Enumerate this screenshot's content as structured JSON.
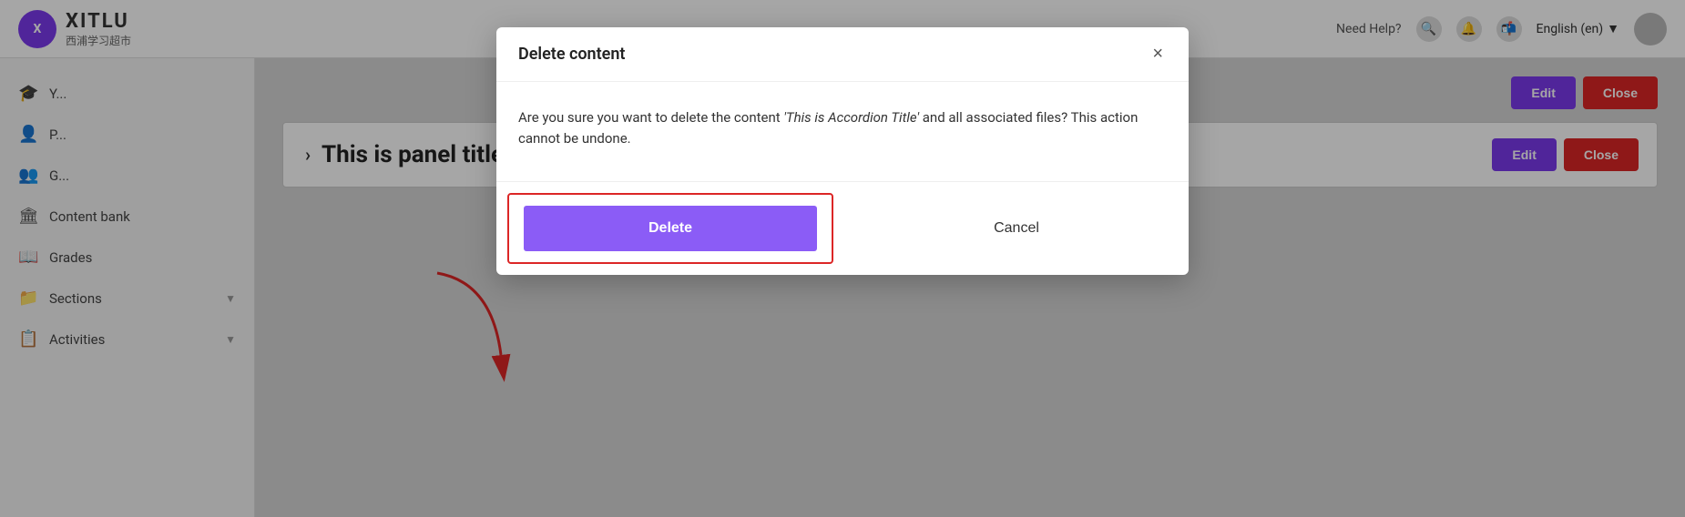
{
  "topbar": {
    "logo_initial": "X",
    "logo_text": "XITLU",
    "logo_subtitle": "西浦学习超市",
    "nav_help": "Need Help?",
    "lang": "English (en)",
    "lang_arrow": "▼"
  },
  "sidebar": {
    "items": [
      {
        "id": "courses",
        "icon": "🎓",
        "label": "Y...",
        "has_arrow": false
      },
      {
        "id": "profile",
        "icon": "👤",
        "label": "P...",
        "has_arrow": false
      },
      {
        "id": "groups",
        "icon": "👥",
        "label": "G...",
        "has_arrow": false
      },
      {
        "id": "content-bank",
        "icon": "🏛",
        "label": "Content bank",
        "has_arrow": false
      },
      {
        "id": "grades",
        "icon": "📖",
        "label": "Grades",
        "has_arrow": false
      },
      {
        "id": "sections",
        "icon": "📁",
        "label": "Sections",
        "has_arrow": true
      },
      {
        "id": "activities",
        "icon": "📋",
        "label": "Activities",
        "has_arrow": true
      }
    ]
  },
  "main": {
    "accordion_chevron": "›",
    "accordion_title": "This is panel title",
    "edit_label": "Edit",
    "close_label": "Close",
    "edit_label_2": "Edit",
    "close_label_2": "Close"
  },
  "modal": {
    "title": "Delete content",
    "close_icon": "×",
    "message_before": "Are you sure you want to delete the content ",
    "message_italic": "'This is Accordion Title'",
    "message_after": " and all associated files? This action cannot be undone.",
    "delete_label": "Delete",
    "cancel_label": "Cancel"
  }
}
